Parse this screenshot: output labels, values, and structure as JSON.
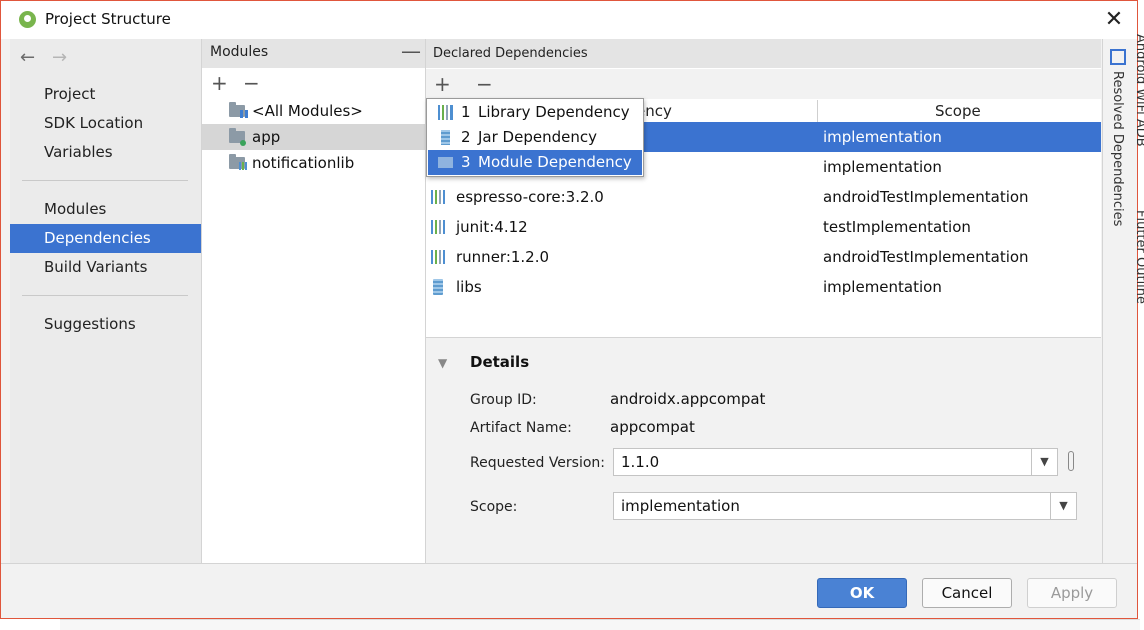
{
  "window": {
    "title": "Project Structure"
  },
  "nav": {
    "back_icon": "←",
    "forward_icon": "→",
    "items": [
      {
        "label": "Project"
      },
      {
        "label": "SDK Location"
      },
      {
        "label": "Variables"
      },
      {
        "label": "Modules"
      },
      {
        "label": "Dependencies",
        "selected": true
      },
      {
        "label": "Build Variants"
      },
      {
        "label": "Suggestions"
      }
    ]
  },
  "modules": {
    "header": "Modules",
    "items": [
      {
        "label": "<All Modules>"
      },
      {
        "label": "app",
        "selected": true
      },
      {
        "label": "notificationlib"
      }
    ]
  },
  "dependencies": {
    "header": "Declared Dependencies",
    "columns": [
      "ency",
      "Scope"
    ],
    "rows": [
      {
        "name": "",
        "scope": "implementation",
        "selected": true
      },
      {
        "name": "",
        "scope": "implementation"
      },
      {
        "name": "espresso-core:3.2.0",
        "scope": "androidTestImplementation"
      },
      {
        "name": "junit:4.12",
        "scope": "testImplementation"
      },
      {
        "name": "runner:1.2.0",
        "scope": "androidTestImplementation"
      },
      {
        "name": "libs",
        "scope": "implementation"
      }
    ]
  },
  "popup": {
    "items": [
      {
        "num": "1",
        "label": "Library Dependency"
      },
      {
        "num": "2",
        "label": "Jar Dependency"
      },
      {
        "num": "3",
        "label": "Module Dependency",
        "selected": true
      }
    ]
  },
  "details": {
    "title": "Details",
    "group_id_label": "Group ID:",
    "group_id": "androidx.appcompat",
    "artifact_label": "Artifact Name:",
    "artifact": "appcompat",
    "version_label": "Requested Version:",
    "version": "1.1.0",
    "scope_label": "Scope:",
    "scope": "implementation"
  },
  "right_strip": {
    "resolved": "Resolved Dependencies",
    "android_wifi": "Android WiFi ADB",
    "flutter": "Flutter Outline"
  },
  "buttons": {
    "ok": "OK",
    "cancel": "Cancel",
    "apply": "Apply"
  },
  "colors": {
    "selection": "#3b73d0",
    "accent_ok": "#4a82d4",
    "window_border": "#e0563c"
  }
}
